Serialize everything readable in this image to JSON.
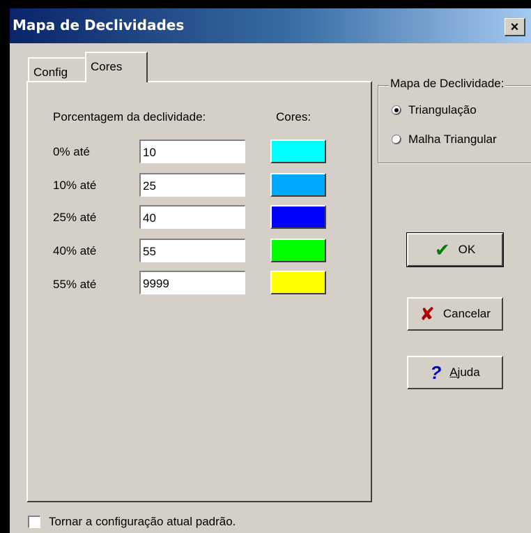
{
  "window": {
    "title": "Mapa de Declividades",
    "close_glyph": "×"
  },
  "tabs": [
    {
      "label": "Config",
      "active": false
    },
    {
      "label": "Cores",
      "active": true
    }
  ],
  "cores_panel": {
    "header_percent": "Porcentagem da declividade:",
    "header_colors": "Cores:",
    "rows": [
      {
        "label": "0% até",
        "value": "10",
        "color": "#00ffff"
      },
      {
        "label": "10% até",
        "value": "25",
        "color": "#00a8ff"
      },
      {
        "label": "25% até",
        "value": "40",
        "color": "#0000ff"
      },
      {
        "label": "40% até",
        "value": "55",
        "color": "#00ff00"
      },
      {
        "label": "55% até",
        "value": "9999",
        "color": "#ffff00"
      }
    ]
  },
  "slope_map_group": {
    "title": "Mapa de Declividade:",
    "options": [
      {
        "label": "Triangulação",
        "selected": true
      },
      {
        "label": "Malha Triangular",
        "selected": false
      }
    ]
  },
  "buttons": {
    "ok": {
      "label": "OK",
      "icon": "check-icon"
    },
    "cancel": {
      "label": "Cancelar",
      "icon": "x-icon"
    },
    "help": {
      "label": "Ajuda",
      "icon": "question-icon"
    }
  },
  "default_config_checkbox": {
    "label": "Tornar a configuração atual padrão.",
    "checked": false
  },
  "colors": {
    "face": "#d4d0c8",
    "title_start": "#0a246a",
    "title_end": "#a6caf0"
  }
}
